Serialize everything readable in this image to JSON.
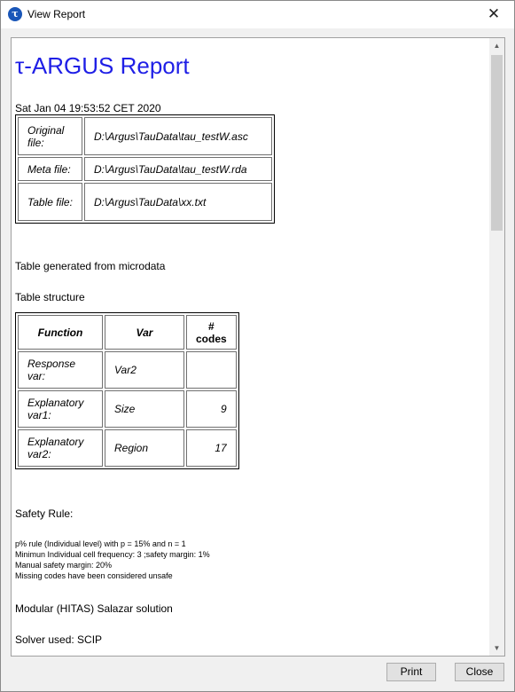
{
  "window": {
    "title": "View Report",
    "app_icon_glyph": "τ",
    "close_glyph": "✕"
  },
  "report": {
    "title": "τ-ARGUS Report",
    "date": "Sat Jan 04 19:53:52 CET 2020",
    "files": [
      {
        "label": "Original file:",
        "value": "D:\\Argus\\TauData\\tau_testW.asc"
      },
      {
        "label": "Meta file:",
        "value": "D:\\Argus\\TauData\\tau_testW.rda"
      },
      {
        "label": "Table file:",
        "value": "D:\\Argus\\TauData\\xx.txt"
      }
    ],
    "generated_from": "Table generated from microdata",
    "structure_heading": "Table structure",
    "structure": {
      "headers": [
        "Function",
        "Var",
        "# codes"
      ],
      "rows": [
        {
          "function": "Response var:",
          "var": "Var2",
          "codes": ""
        },
        {
          "function": "Explanatory var1:",
          "var": "Size",
          "codes": "9"
        },
        {
          "function": "Explanatory var2:",
          "var": "Region",
          "codes": "17"
        }
      ]
    },
    "safety_heading": "Safety Rule:",
    "safety_lines": [
      "p% rule (Individual level) with p = 15% and n = 1",
      "Minimun Individual cell frequency: 3 ;safety margin: 1%",
      "Manual safety margin: 20%",
      "Missing codes have been considered unsafe"
    ],
    "solution": "Modular (HITAS) Salazar solution",
    "solver": "Solver used: SCIP"
  },
  "scrollbar": {
    "up_glyph": "▲",
    "down_glyph": "▼"
  },
  "buttons": {
    "print": "Print",
    "close": "Close"
  }
}
